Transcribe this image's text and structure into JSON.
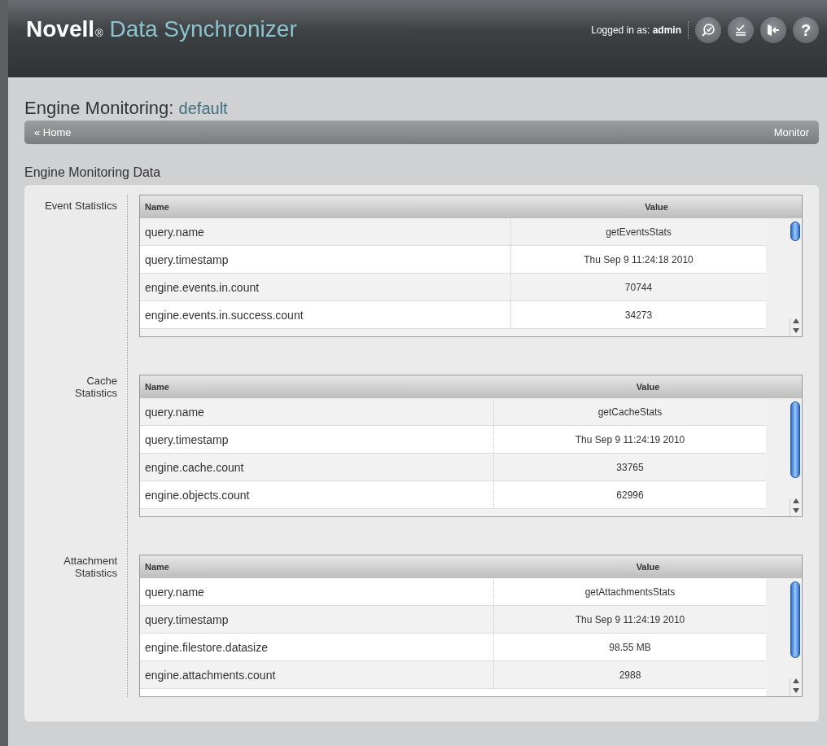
{
  "header": {
    "brand": "Novell",
    "registered": "®",
    "product": "Data Synchronizer",
    "login": "Logged in as: **admin**",
    "help": "?"
  },
  "page": {
    "title": "Engine Monitoring:",
    "subtitle": "default"
  },
  "breadcrumb": {
    "home": "« Home",
    "current": "Monitor"
  },
  "section_title": "Engine Monitoring Data",
  "groups": [
    {
      "label": "Event Statistics",
      "columns": [
        "Name",
        "Value"
      ],
      "rows": [
        {
          "name": "query.name",
          "value": "getEventsStats"
        },
        {
          "name": "query.timestamp",
          "value": "Thu Sep 9 11:24:18 2010"
        },
        {
          "name": "engine.events.in.count",
          "value": "70744"
        },
        {
          "name": "engine.events.in.success.count",
          "value": "34273"
        }
      ]
    },
    {
      "label": "Cache Statistics",
      "columns": [
        "Name",
        "Value"
      ],
      "rows": [
        {
          "name": "query.name",
          "value": "getCacheStats"
        },
        {
          "name": "query.timestamp",
          "value": "Thu Sep 9 11:24:19 2010"
        },
        {
          "name": "engine.cache.count",
          "value": "33765"
        },
        {
          "name": "engine.objects.count",
          "value": "62996"
        }
      ]
    },
    {
      "label": "Attachment Statistics",
      "columns": [
        "Name",
        "Value"
      ],
      "rows": [
        {
          "name": "query.name",
          "value": "getAttachmentsStats"
        },
        {
          "name": "query.timestamp",
          "value": "Thu Sep 9 11:24:19 2010"
        },
        {
          "name": "engine.filestore.datasize",
          "value": "98.55 MB"
        },
        {
          "name": "engine.attachments.count",
          "value": "2988"
        }
      ]
    }
  ]
}
